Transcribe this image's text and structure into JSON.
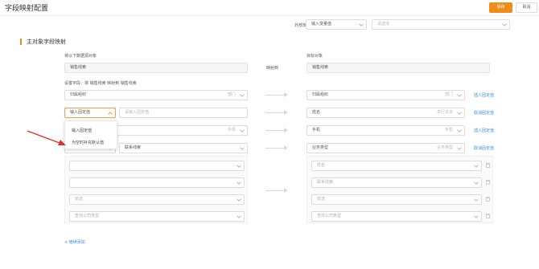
{
  "header": {
    "title": "字段映射配置",
    "save_label": "保存",
    "cancel_label": "取消"
  },
  "top_filter": {
    "label": "外部负责人",
    "type_value": "输入变量值",
    "select_placeholder": "请选择"
  },
  "section": {
    "title": "主对象字段映射",
    "source_label": "将以下数据源对象",
    "source_value": "销售线索",
    "map_to_label": "映射到",
    "target_label": "目标对象",
    "target_value": "销售线索",
    "field_setting_label": "设置字段：将 销售线索 映射到 销售线索"
  },
  "rows": [
    {
      "source": "归属组织",
      "source_hint": "部门",
      "target": "归属组织",
      "target_hint": "部门",
      "action": "插入固定值"
    },
    {
      "source": "输入固定值",
      "source_input_placeholder": "请输入固定值",
      "target": "姓名",
      "target_hint": "单行文本",
      "action": "取消固定值"
    },
    {
      "source": "",
      "source_hint": "手机",
      "target": "手机",
      "target_hint": "手机",
      "action": "插入固定值"
    },
    {
      "source": "联系线索",
      "target": "业务类型",
      "target_hint": "业务类型",
      "action": "取消固定值"
    }
  ],
  "empty_rows": [
    {
      "source": "",
      "target": "姓名"
    },
    {
      "source": "",
      "target": "联系线索"
    },
    {
      "source": "单选",
      "target": "单选"
    },
    {
      "source": "查找公司类型",
      "target": "查找公司类型"
    }
  ],
  "dropdown": {
    "options": [
      "输入固定值",
      "为空时补充默认值"
    ]
  },
  "add_more_label": "+ 继续添加",
  "colors": {
    "accent": "#f08c1a",
    "link": "#3d8bdc",
    "annotation_arrow": "#e0322c"
  }
}
